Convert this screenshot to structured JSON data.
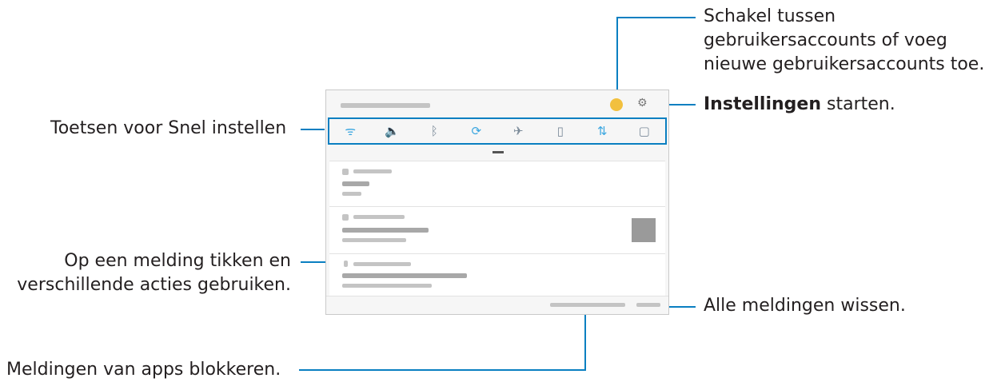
{
  "callouts": {
    "switch_accounts": {
      "line1": "Schakel tussen",
      "line2": "gebruikersaccounts of voeg",
      "line3": "nieuwe gebruikersaccounts toe."
    },
    "settings": {
      "bold": "Instellingen",
      "rest": " starten."
    },
    "quick_settings": "Toetsen voor Snel instellen",
    "notification_tap": {
      "line1": "Op een melding tikken en",
      "line2": "verschillende acties gebruiken."
    },
    "clear_all": "Alle meldingen wissen.",
    "block_apps": "Meldingen van apps blokkeren."
  },
  "panel": {
    "quick_toggles": [
      {
        "icon": "wifi-icon",
        "glyph": "ᯤ",
        "active": true
      },
      {
        "icon": "sound-icon",
        "glyph": "🔈",
        "active": false
      },
      {
        "icon": "bluetooth-icon",
        "glyph": "ᛒ",
        "active": false
      },
      {
        "icon": "rotate-icon",
        "glyph": "⟳",
        "active": true
      },
      {
        "icon": "airplane-icon",
        "glyph": "✈",
        "active": false
      },
      {
        "icon": "power-saving-icon",
        "glyph": "▯",
        "active": false
      },
      {
        "icon": "mobile-data-icon",
        "glyph": "⇅",
        "active": true
      },
      {
        "icon": "flashlight-icon",
        "glyph": "▢",
        "active": false
      }
    ]
  },
  "colors": {
    "accent": "#0a7fc1",
    "avatar": "#f2c03e"
  }
}
